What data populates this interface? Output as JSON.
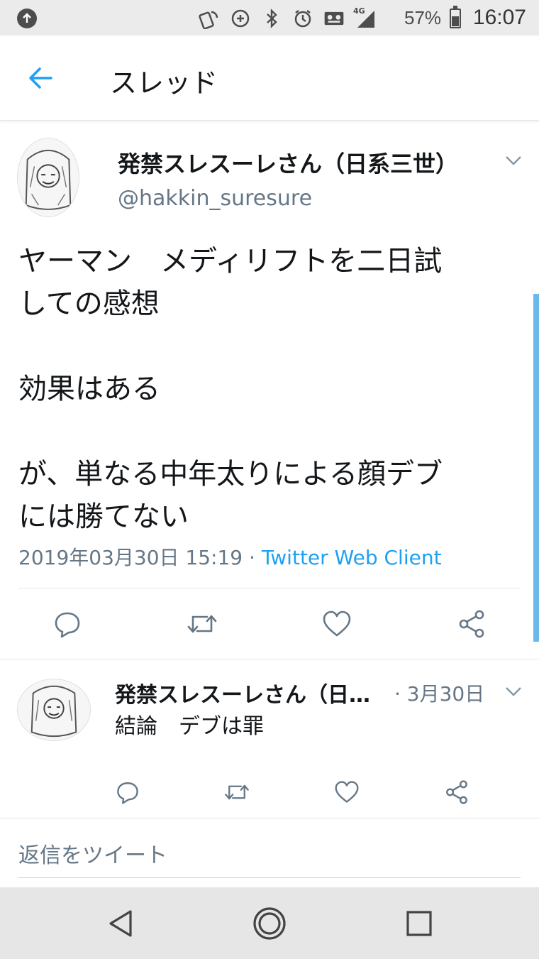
{
  "status_bar": {
    "battery_pct": "57%",
    "battery_level": 0.57,
    "time": "16:07",
    "network": "4G"
  },
  "header": {
    "title": "スレッド",
    "back_icon": "arrow-left-icon"
  },
  "main_tweet": {
    "name": "発禁スレスーレさん（日系三世）",
    "handle": "@hakkin_suresure",
    "text": "ヤーマン　メディリフトを二日試\nしての感想\n\n効果はある\n\nが、単なる中年太りによる顔デブ\nには勝てない",
    "timestamp": "2019年03月30日 15:19",
    "separator": " · ",
    "client": "Twitter Web Client"
  },
  "reply_tweet": {
    "name": "発禁スレスーレさん（日…",
    "date": "· 3月30日",
    "text": "結論　デブは罪"
  },
  "compose": {
    "placeholder": "返信をツイート"
  },
  "colors": {
    "accent": "#1da1f2",
    "secondary_text": "#657786",
    "scroll": "#6cb9e9"
  }
}
